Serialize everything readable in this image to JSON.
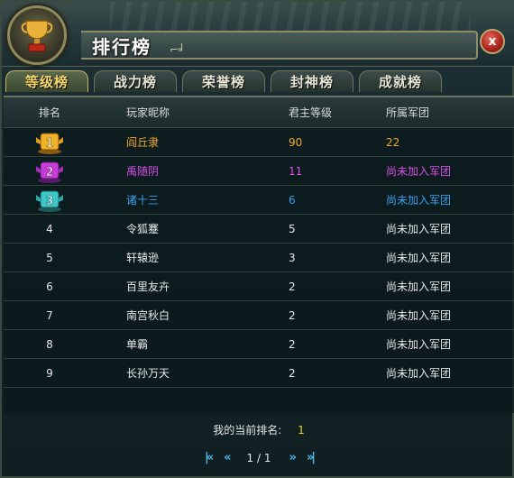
{
  "window": {
    "title": "排行榜",
    "close_label": "x"
  },
  "tabs": [
    {
      "label": "等级榜",
      "active": true
    },
    {
      "label": "战力榜",
      "active": false
    },
    {
      "label": "荣誉榜",
      "active": false
    },
    {
      "label": "封神榜",
      "active": false
    },
    {
      "label": "成就榜",
      "active": false
    }
  ],
  "table": {
    "headers": [
      "排名",
      "玩家昵称",
      "君主等级",
      "所属军团"
    ],
    "rows": [
      {
        "rank": "1",
        "name": "阎丘隶",
        "level": "90",
        "legion": "22",
        "color": "#f0a82c",
        "medal": "gold"
      },
      {
        "rank": "2",
        "name": "禹随阴",
        "level": "11",
        "legion": "尚未加入军团",
        "color": "#d64ee6",
        "medal": "purple"
      },
      {
        "rank": "3",
        "name": "诸十三",
        "level": "6",
        "legion": "尚未加入军团",
        "color": "#3aa0f0",
        "medal": "teal"
      },
      {
        "rank": "4",
        "name": "令狐蹇",
        "level": "5",
        "legion": "尚未加入军团"
      },
      {
        "rank": "5",
        "name": "轩辕逊",
        "level": "3",
        "legion": "尚未加入军团"
      },
      {
        "rank": "6",
        "name": "百里友卉",
        "level": "2",
        "legion": "尚未加入军团"
      },
      {
        "rank": "7",
        "name": "南宫秋白",
        "level": "2",
        "legion": "尚未加入军团"
      },
      {
        "rank": "8",
        "name": "单霸",
        "level": "2",
        "legion": "尚未加入军团"
      },
      {
        "rank": "9",
        "name": "长孙万天",
        "level": "2",
        "legion": "尚未加入军团"
      }
    ]
  },
  "footer": {
    "my_rank_label": "我的当前排名:",
    "my_rank_value": "1"
  },
  "pager": {
    "first": "|«",
    "prev": "«",
    "page_text": "1 / 1",
    "next": "»",
    "last": "»|"
  },
  "colors": {
    "rank1": "#f0a82c",
    "rank2": "#d64ee6",
    "rank3": "#3aa0f0",
    "accent_tab": "#f6d66b"
  }
}
